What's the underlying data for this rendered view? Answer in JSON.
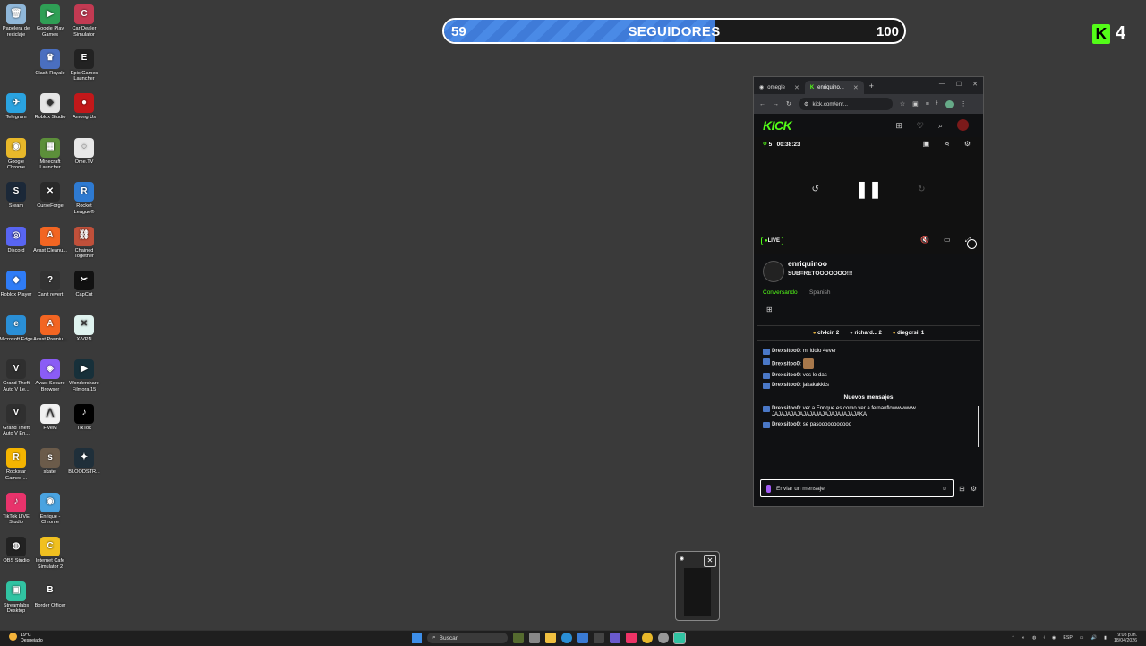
{
  "desktop_icons": [
    {
      "label": "Papelera de reciclaje",
      "icon": "recycle-bin-icon",
      "color": "#8fb7d9",
      "glyph": "🗑"
    },
    {
      "label": "Google Play Games",
      "icon": "play-games-icon",
      "color": "#2f9f55",
      "glyph": "▶"
    },
    {
      "label": "Car Dealer Simulator",
      "icon": "car-dealer-icon",
      "color": "#c23a52",
      "glyph": "C"
    },
    {
      "label": "Clash Royale",
      "icon": "clash-royale-icon",
      "color": "#4a6fc0",
      "glyph": "♛"
    },
    {
      "label": "Epic Games Launcher",
      "icon": "epic-games-icon",
      "color": "#222222",
      "glyph": "E"
    },
    {
      "label": "Telegram",
      "icon": "telegram-icon",
      "color": "#2aa3e0",
      "glyph": "✈"
    },
    {
      "label": "Roblox Studio",
      "icon": "roblox-studio-icon",
      "color": "#e5e5e5",
      "glyph": "◆"
    },
    {
      "label": "Among Us",
      "icon": "among-us-icon",
      "color": "#c2181a",
      "glyph": "●"
    },
    {
      "label": "Google Chrome",
      "icon": "chrome-icon",
      "color": "#e8b82a",
      "glyph": "◉"
    },
    {
      "label": "Minecraft Launcher",
      "icon": "minecraft-icon",
      "color": "#5c8f3a",
      "glyph": "▦"
    },
    {
      "label": "Ome.TV",
      "icon": "ometv-icon",
      "color": "#e8e8e8",
      "glyph": "◌"
    },
    {
      "label": "Steam",
      "icon": "steam-icon",
      "color": "#1b2838",
      "glyph": "S"
    },
    {
      "label": "CurseForge",
      "icon": "curseforge-icon",
      "color": "#2a2a2a",
      "glyph": "✕"
    },
    {
      "label": "Rocket League®",
      "icon": "rocket-league-icon",
      "color": "#2e7ad1",
      "glyph": "R"
    },
    {
      "label": "Discord",
      "icon": "discord-icon",
      "color": "#5865f2",
      "glyph": "◎"
    },
    {
      "label": "Avast Cleanu...",
      "icon": "avast-cleanup-icon",
      "color": "#f26522",
      "glyph": "A"
    },
    {
      "label": "Chained Together",
      "icon": "chained-together-icon",
      "color": "#c0503a",
      "glyph": "⛓"
    },
    {
      "label": "Roblox Player",
      "icon": "roblox-player-icon",
      "color": "#2f7cf6",
      "glyph": "◆"
    },
    {
      "label": "Can't revert",
      "icon": "cant-revert-icon",
      "color": "#333333",
      "glyph": "?"
    },
    {
      "label": "CapCut",
      "icon": "capcut-icon",
      "color": "#111111",
      "glyph": "✂"
    },
    {
      "label": "Microsoft Edge",
      "icon": "edge-icon",
      "color": "#2a8fd6",
      "glyph": "e"
    },
    {
      "label": "Avast Premiu...",
      "icon": "avast-premium-icon",
      "color": "#f26522",
      "glyph": "A"
    },
    {
      "label": "X-VPN",
      "icon": "xvpn-icon",
      "color": "#dff3ef",
      "glyph": "✕"
    },
    {
      "label": "Grand Theft Auto V Le...",
      "icon": "gta-legacy-icon",
      "color": "#2f2f2f",
      "glyph": "V"
    },
    {
      "label": "Avast Secure Browser",
      "icon": "avast-browser-icon",
      "color": "#8a5cf5",
      "glyph": "◈"
    },
    {
      "label": "Wondershare Filmora 15",
      "icon": "filmora-icon",
      "color": "#17303a",
      "glyph": "▶"
    },
    {
      "label": "Grand Theft Auto V En...",
      "icon": "gta-enhanced-icon",
      "color": "#2f2f2f",
      "glyph": "V"
    },
    {
      "label": "FiveM",
      "icon": "fivem-icon",
      "color": "#f1f1f1",
      "glyph": "⋀"
    },
    {
      "label": "TikTok",
      "icon": "tiktok-icon",
      "color": "#000000",
      "glyph": "♪"
    },
    {
      "label": "Rockstar Games ...",
      "icon": "rockstar-icon",
      "color": "#f4b400",
      "glyph": "R"
    },
    {
      "label": "skate.",
      "icon": "skate-icon",
      "color": "#6b5b4a",
      "glyph": "s"
    },
    {
      "label": "BLOODSTR...",
      "icon": "bloodstrike-icon",
      "color": "#1f2f3a",
      "glyph": "✦"
    },
    {
      "label": "TikTok LIVE Studio",
      "icon": "tiktok-live-icon",
      "color": "#e8336b",
      "glyph": "♪"
    },
    {
      "label": "Enrique - Chrome",
      "icon": "chrome-profile-icon",
      "color": "#4aa3e0",
      "glyph": "◉"
    },
    {
      "label": "OBS Studio",
      "icon": "obs-icon",
      "color": "#222222",
      "glyph": "◍"
    },
    {
      "label": "Internet Cafe Simulator 2",
      "icon": "internet-cafe-icon",
      "color": "#f0c020",
      "glyph": "C"
    },
    {
      "label": "Streamlabs Desktop",
      "icon": "streamlabs-icon",
      "color": "#31c3a2",
      "glyph": "▣"
    },
    {
      "label": "Border Officer",
      "icon": "border-officer-icon",
      "color": "#3a3a3a",
      "glyph": "B"
    }
  ],
  "follower_goal": {
    "current": "59",
    "label": "SEGUIDORES",
    "target": "100",
    "progress": 0.59,
    "fill_color": "#4a8ae6"
  },
  "kick_badge": {
    "count": "4",
    "color": "#53fc18"
  },
  "browser": {
    "tabs": [
      {
        "label": "omegle",
        "active": false
      },
      {
        "label": "enriquino...",
        "active": true
      }
    ],
    "url": "kick.com/enr...",
    "kick_logo": "KICK",
    "viewers": "5",
    "uptime": "00:38:23",
    "live_label": "LIVE",
    "channel_name": "enriquinoo",
    "stream_title": "SUB=RETOOOOOOO!!!",
    "category": "Conversando",
    "language": "Spanish",
    "gifters": [
      {
        "name": "ch4cin",
        "count": "2"
      },
      {
        "name": "richard...",
        "count": "2"
      },
      {
        "name": "diegorsil",
        "count": "1"
      }
    ],
    "chat": {
      "messages_before": [
        {
          "user": "Drexsitoo0:",
          "text": "mi idolo 4ever"
        },
        {
          "user": "Drexsitoo0:",
          "text": "",
          "emote": true
        },
        {
          "user": "Drexsitoo0:",
          "text": "vos le das"
        },
        {
          "user": "Drexsitoo0:",
          "text": "jakakakkks"
        }
      ],
      "new_messages_label": "Nuevos mensajes",
      "messages_after": [
        {
          "user": "Drexsitoo0:",
          "text": "ver a Enrique es como ver a fernanflowwwwww JAJAJAJAJAJAJAJAJAJAJAJAJAJAKA"
        },
        {
          "user": "Drexsitoo0:",
          "text": "se pasooooooooooo"
        }
      ],
      "input_placeholder": "Enviar un mensaje"
    }
  },
  "taskbar": {
    "weather_temp": "19°C",
    "weather_desc": "Despejado",
    "search_label": "Buscar",
    "lang": "ESP",
    "time": "9:08 p.m.",
    "date": "18/04/2026"
  }
}
